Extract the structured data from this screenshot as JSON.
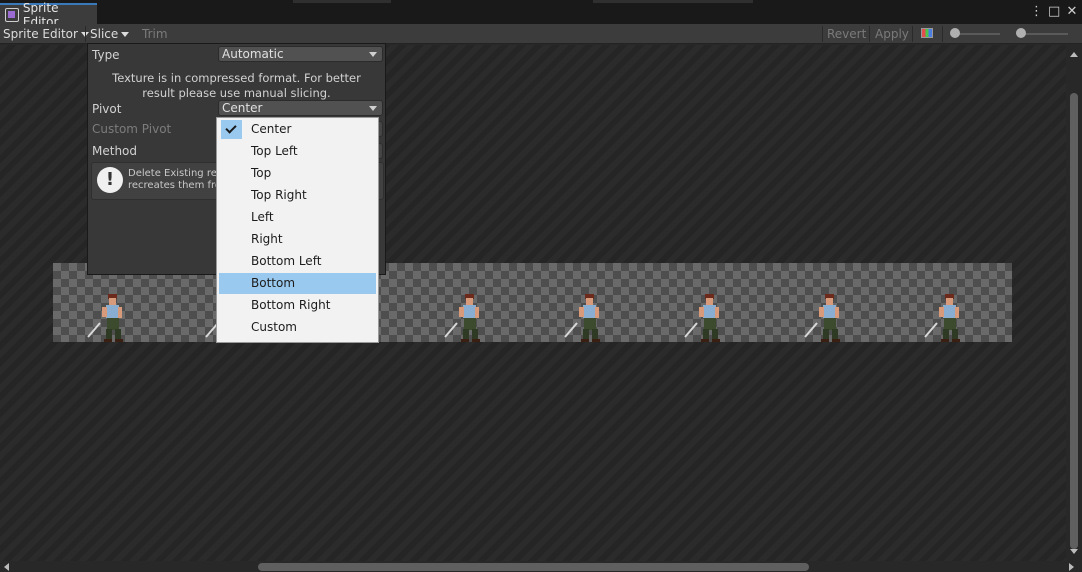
{
  "window": {
    "tab_title": "Sprite Editor",
    "controls": {
      "more": "⋮",
      "maximize": "□",
      "close": "✕"
    }
  },
  "toolbar": {
    "mode_label": "Sprite Editor",
    "slice_label": "Slice",
    "trim_label": "Trim",
    "revert_label": "Revert",
    "apply_label": "Apply"
  },
  "slice_panel": {
    "type_label": "Type",
    "type_value": "Automatic",
    "notice": "Texture is in compressed format. For better result please use manual slicing.",
    "pivot_label": "Pivot",
    "pivot_value": "Center",
    "custom_pivot_label": "Custom Pivot",
    "method_label": "Method",
    "help_text": "Delete Existing rem\nrecreates them fro"
  },
  "pivot_menu": {
    "items": [
      "Center",
      "Top Left",
      "Top",
      "Top Right",
      "Left",
      "Right",
      "Bottom Left",
      "Bottom",
      "Bottom Right",
      "Custom"
    ],
    "checked": "Center",
    "highlighted": "Bottom"
  },
  "texture": {
    "frames": 8
  }
}
